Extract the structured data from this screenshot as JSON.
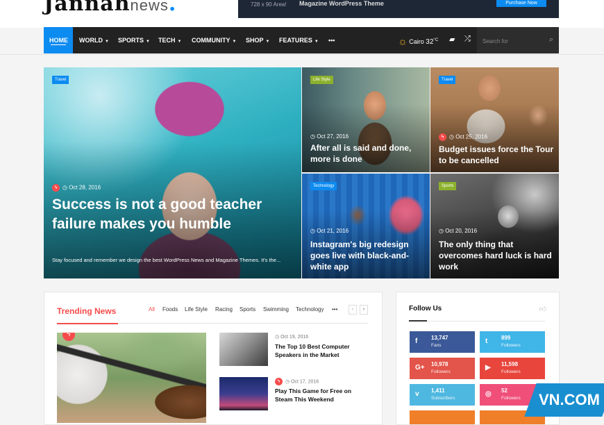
{
  "logo": {
    "main": "Jannah",
    "sub": "news",
    "dot": "."
  },
  "ad": {
    "size": "728 x 90 Area!",
    "text": "Magazine WordPress Theme",
    "button": "Purchase Now"
  },
  "nav": {
    "items": [
      {
        "label": "Home",
        "caret": ""
      },
      {
        "label": "World",
        "caret": "▼"
      },
      {
        "label": "Sports",
        "caret": "▼"
      },
      {
        "label": "Tech",
        "caret": "▼"
      },
      {
        "label": "Community",
        "caret": "▼"
      },
      {
        "label": "Shop",
        "caret": "▼"
      },
      {
        "label": "Features",
        "caret": "▼"
      },
      {
        "label": "•••",
        "caret": ""
      }
    ],
    "weather_city": "Cairo",
    "weather_temp": "32",
    "weather_unit": "°C",
    "search_placeholder": "Search for"
  },
  "hero": {
    "category": "Travel",
    "date": "Oct 28, 2016",
    "title": "Success is not a good teacher failure makes you humble",
    "excerpt": "Stay focused and remember we design the best WordPress News and Magazine Themes. It's the..."
  },
  "tiles": [
    {
      "category": "Life Style",
      "date": "Oct 27, 2016",
      "title": "After all is said and done, more is done"
    },
    {
      "category": "Travel",
      "date": "Oct 25, 2016",
      "title": "Budget issues force the Tour to be cancelled"
    },
    {
      "category": "Technology",
      "date": "Oct 21, 2016",
      "title": "Instagram's big redesign goes live with black-and-white app"
    },
    {
      "category": "Sports",
      "date": "Oct 20, 2016",
      "title": "The only thing that overcomes hard luck is hard work"
    }
  ],
  "trending": {
    "title": "Trending News",
    "tabs": [
      "All",
      "Foods",
      "Life Style",
      "Racing",
      "Sports",
      "Swimming",
      "Technology",
      "•••"
    ],
    "prev": "‹",
    "next": "›",
    "items": [
      {
        "date": "Oct 19, 2016",
        "title": "The Top 10 Best Computer Speakers in the Market"
      },
      {
        "date": "Oct 17, 2016",
        "title": "Play This Game for Free on Steam This Weekend"
      }
    ]
  },
  "follow": {
    "title": "Follow Us",
    "networks": [
      {
        "icon": "f",
        "count": "13,747",
        "label": "Fans",
        "color": "#3b5998"
      },
      {
        "icon": "t",
        "count": "899",
        "label": "Followers",
        "color": "#40b5e8"
      },
      {
        "icon": "G+",
        "count": "10,978",
        "label": "Followers",
        "color": "#e3544a"
      },
      {
        "icon": "▶",
        "count": "11,598",
        "label": "Followers",
        "color": "#e8453c"
      },
      {
        "icon": "v",
        "count": "1,411",
        "label": "Subscribers",
        "color": "#4fb8e0"
      },
      {
        "icon": "◎",
        "count": "52",
        "label": "Followers",
        "color": "#f04f7a"
      }
    ]
  },
  "colors": {
    "accent": "#0c8bf1",
    "red": "#f64b4b",
    "nav_bg": "#222222"
  }
}
